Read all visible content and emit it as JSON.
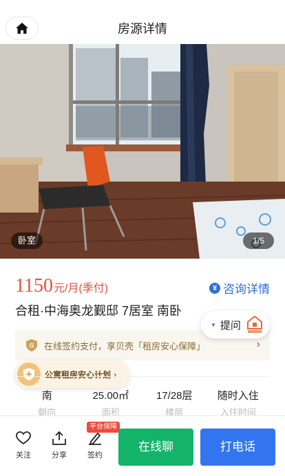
{
  "header": {
    "title": "房源详情",
    "home_icon": "home-icon"
  },
  "gallery": {
    "room_tag": "卧室",
    "counter": "1/5"
  },
  "listing": {
    "price": "1150",
    "price_unit": "元/月(季付)",
    "consult_label": "咨询详情",
    "title": "合租·中海奥龙觐邸 7居室 南卧"
  },
  "ask": {
    "label": "提问"
  },
  "guarantee": {
    "text": "在线签约支付，享贝壳「租房安心保障」"
  },
  "plan": {
    "label": "公寓租房安心计划"
  },
  "facts": [
    {
      "value": "南",
      "label": "朝向"
    },
    {
      "value": "25.00㎡",
      "label": "面积"
    },
    {
      "value": "17/28层",
      "label": "楼层"
    },
    {
      "value": "随时入住",
      "label": "入住时间"
    }
  ],
  "bottom": {
    "follow_label": "关注",
    "share_label": "分享",
    "sign_label": "签约",
    "sign_tag": "平台保障",
    "chat_label": "在线聊",
    "call_label": "打电话"
  },
  "colors": {
    "price": "#e6503d",
    "link": "#2f6fd6",
    "chat_button": "#13b36a",
    "call_button": "#3275ef"
  }
}
